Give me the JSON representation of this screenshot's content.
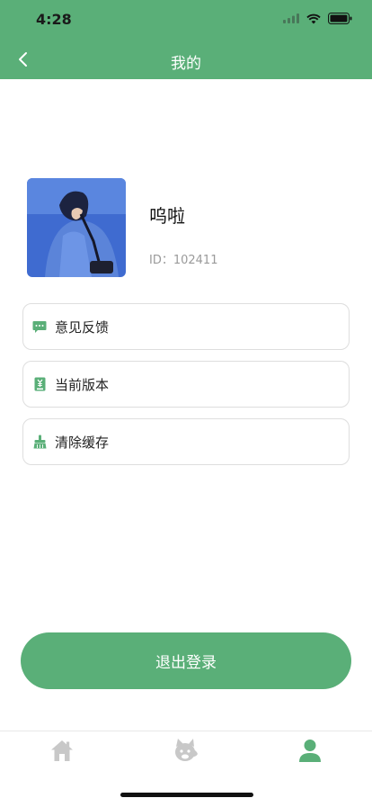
{
  "status_bar": {
    "time": "4:28"
  },
  "header": {
    "title": "我的"
  },
  "profile": {
    "name": "呜啦",
    "id_text": "ID：102411"
  },
  "menu": [
    {
      "label": "意见反馈",
      "icon": "chat-icon"
    },
    {
      "label": "当前版本",
      "icon": "version-icon"
    },
    {
      "label": "清除缓存",
      "icon": "broom-icon"
    }
  ],
  "logout_label": "退出登录",
  "tabbar": {
    "items": [
      {
        "name": "home",
        "icon": "home-icon",
        "active": false
      },
      {
        "name": "pet",
        "icon": "pet-icon",
        "active": false
      },
      {
        "name": "profile",
        "icon": "person-icon",
        "active": true
      }
    ]
  },
  "colors": {
    "brand": "#5aaf78",
    "inactive_tab": "#c8c8c8"
  }
}
